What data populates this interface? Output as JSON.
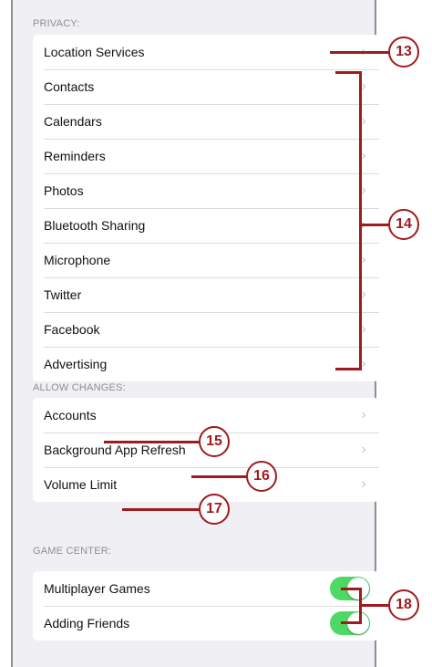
{
  "sections": [
    {
      "header": "PRIVACY:",
      "rows": [
        {
          "label": "Location Services"
        },
        {
          "label": "Contacts"
        },
        {
          "label": "Calendars"
        },
        {
          "label": "Reminders"
        },
        {
          "label": "Photos"
        },
        {
          "label": "Bluetooth Sharing"
        },
        {
          "label": "Microphone"
        },
        {
          "label": "Twitter"
        },
        {
          "label": "Facebook"
        },
        {
          "label": "Advertising"
        }
      ]
    },
    {
      "header": "ALLOW CHANGES:",
      "rows": [
        {
          "label": "Accounts"
        },
        {
          "label": "Background App Refresh"
        },
        {
          "label": "Volume Limit"
        }
      ]
    },
    {
      "header": "GAME CENTER:",
      "rows": [
        {
          "label": "Multiplayer Games",
          "toggle_on": true
        },
        {
          "label": "Adding Friends",
          "toggle_on": true
        }
      ]
    }
  ],
  "chevron_glyph": "›",
  "callouts": [
    "13",
    "14",
    "15",
    "16",
    "17",
    "18"
  ],
  "colors": {
    "callout": "#9e1b1e",
    "toggle_on": "#4cd964"
  }
}
